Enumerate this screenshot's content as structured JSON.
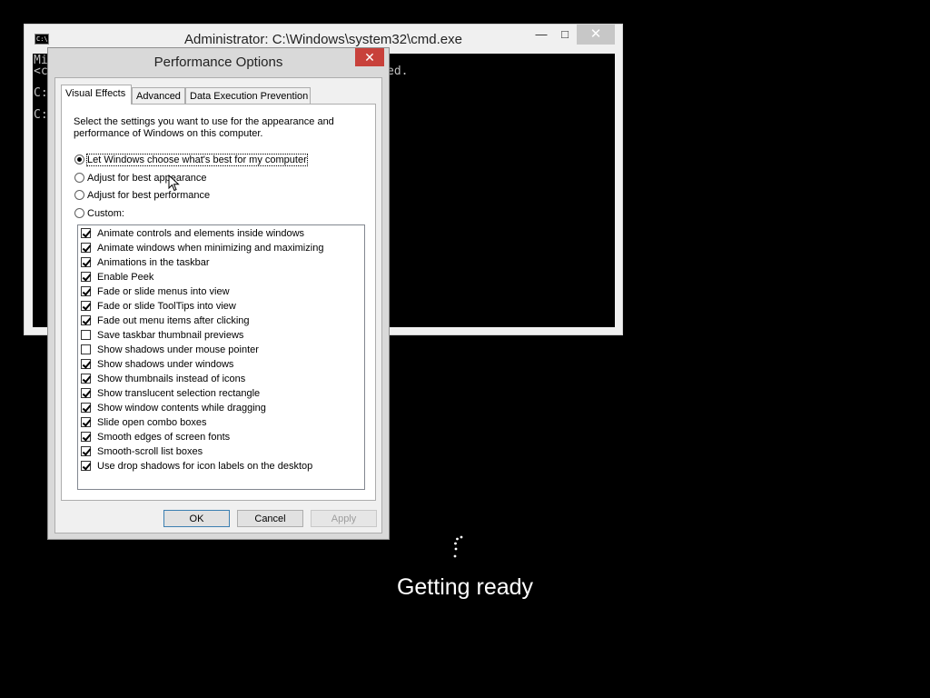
{
  "cmd": {
    "title": "Administrator: C:\\Windows\\system32\\cmd.exe",
    "icon_text": "C:\\.",
    "min_label": "—",
    "max_label": "□",
    "close_label": "✕",
    "lines": [
      "Mi",
      "<c",
      "",
      "C:",
      "",
      "C:"
    ],
    "partial_text": "ed."
  },
  "dialog": {
    "title": "Performance Options",
    "close_label": "✕",
    "tabs": [
      "Visual Effects",
      "Advanced",
      "Data Execution Prevention"
    ],
    "description": "Select the settings you want to use for the appearance and performance of Windows on this computer.",
    "radios": [
      {
        "label": "Let Windows choose what's best for my computer",
        "checked": true
      },
      {
        "label": "Adjust for best appearance",
        "checked": false
      },
      {
        "label": "Adjust for best performance",
        "checked": false
      },
      {
        "label": "Custom:",
        "checked": false
      }
    ],
    "options": [
      {
        "label": "Animate controls and elements inside windows",
        "checked": true
      },
      {
        "label": "Animate windows when minimizing and maximizing",
        "checked": true
      },
      {
        "label": "Animations in the taskbar",
        "checked": true
      },
      {
        "label": "Enable Peek",
        "checked": true
      },
      {
        "label": "Fade or slide menus into view",
        "checked": true
      },
      {
        "label": "Fade or slide ToolTips into view",
        "checked": true
      },
      {
        "label": "Fade out menu items after clicking",
        "checked": true
      },
      {
        "label": "Save taskbar thumbnail previews",
        "checked": false
      },
      {
        "label": "Show shadows under mouse pointer",
        "checked": false
      },
      {
        "label": "Show shadows under windows",
        "checked": true
      },
      {
        "label": "Show thumbnails instead of icons",
        "checked": true
      },
      {
        "label": "Show translucent selection rectangle",
        "checked": true
      },
      {
        "label": "Show window contents while dragging",
        "checked": true
      },
      {
        "label": "Slide open combo boxes",
        "checked": true
      },
      {
        "label": "Smooth edges of screen fonts",
        "checked": true
      },
      {
        "label": "Smooth-scroll list boxes",
        "checked": true
      },
      {
        "label": "Use drop shadows for icon labels on the desktop",
        "checked": true
      }
    ],
    "buttons": {
      "ok": "OK",
      "cancel": "Cancel",
      "apply": "Apply"
    }
  },
  "status": {
    "text": "Getting ready"
  }
}
